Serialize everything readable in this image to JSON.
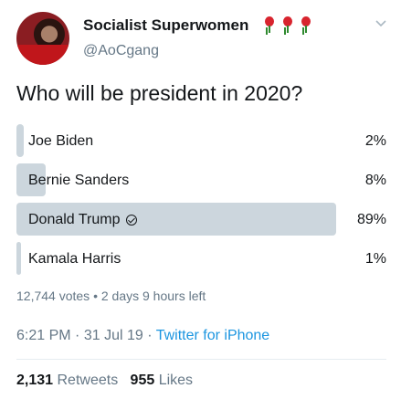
{
  "user": {
    "display_name": "Socialist Superwomen",
    "handle": "@AoCgang",
    "name_emoji": [
      "rose",
      "rose",
      "rose"
    ]
  },
  "tweet": {
    "question": "Who will be president in 2020?",
    "poll": {
      "options": [
        {
          "label": "Joe Biden",
          "percent": "2%",
          "value": 2,
          "selected": false
        },
        {
          "label": "Bernie Sanders",
          "percent": "8%",
          "value": 8,
          "selected": false
        },
        {
          "label": "Donald Trump",
          "percent": "89%",
          "value": 89,
          "selected": true
        },
        {
          "label": "Kamala Harris",
          "percent": "1%",
          "value": 1,
          "selected": false
        }
      ],
      "votes": "12,744 votes",
      "separator": "•",
      "time_left": "2 days 9 hours left"
    },
    "time": "6:21 PM",
    "date": "31 Jul 19",
    "dot": "·",
    "source": "Twitter for iPhone",
    "retweets_count": "2,131",
    "retweets_label": "Retweets",
    "likes_count": "955",
    "likes_label": "Likes"
  },
  "colors": {
    "bar": "#ccd6dd",
    "secondary_text": "#657786",
    "link": "#1b95e0"
  }
}
